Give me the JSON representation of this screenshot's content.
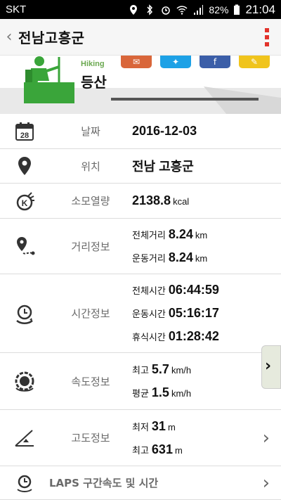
{
  "status": {
    "carrier": "SKT",
    "battery": "82%",
    "time": "21:04"
  },
  "titlebar": {
    "title": "전남고흥군"
  },
  "banner": {
    "activity_en": "Hiking",
    "activity_ko": "등산"
  },
  "rows": {
    "date": {
      "label": "날짜",
      "value": "2016-12-03"
    },
    "location": {
      "label": "위치",
      "value": "전남 고흥군"
    },
    "calories": {
      "label": "소모열량",
      "value": "2138.8",
      "unit": "kcal"
    },
    "distance": {
      "label": "거리정보",
      "total_label": "전체거리",
      "total_value": "8.24",
      "total_unit": "km",
      "moving_label": "운동거리",
      "moving_value": "8.24",
      "moving_unit": "km"
    },
    "time": {
      "label": "시간정보",
      "total_label": "전체시간",
      "total_value": "06:44:59",
      "moving_label": "운동시간",
      "moving_value": "05:16:17",
      "rest_label": "휴식시간",
      "rest_value": "01:28:42"
    },
    "speed": {
      "label": "속도정보",
      "max_label": "최고",
      "max_value": "5.7",
      "max_unit": "km/h",
      "avg_label": "평균",
      "avg_value": "1.5",
      "avg_unit": "km/h"
    },
    "altitude": {
      "label": "고도정보",
      "min_label": "최저",
      "min_value": "31",
      "min_unit": "m",
      "max_label": "최고",
      "max_value": "631",
      "max_unit": "m"
    },
    "laps": {
      "label": "LAPS 구간속도 및 시간"
    }
  }
}
